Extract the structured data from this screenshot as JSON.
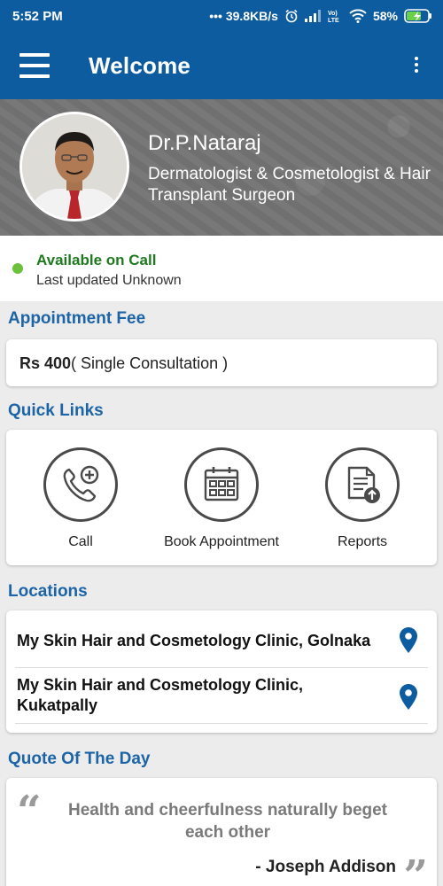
{
  "status_bar": {
    "time": "5:52 PM",
    "network_speed": "••• 39.8KB/s",
    "battery": "58%",
    "icons": [
      "alarm-icon",
      "signal-icon",
      "volte-icon",
      "wifi-icon",
      "battery-charging-icon"
    ]
  },
  "app_bar": {
    "title": "Welcome",
    "menu_icon": "hamburger-menu-icon",
    "overflow_icon": "more-vertical-icon"
  },
  "doctor": {
    "name": "Dr.P.Nataraj",
    "specialty": "Dermatologist & Cosmetologist & Hair Transplant Surgeon"
  },
  "availability": {
    "status": "Available on Call",
    "last_updated": "Last updated Unknown",
    "status_color": "#6cc13b"
  },
  "appointment_fee": {
    "section_title": "Appointment Fee",
    "amount": "Rs 400",
    "description": "( Single Consultation )"
  },
  "quick_links": {
    "section_title": "Quick Links",
    "items": [
      {
        "label": "Call",
        "icon": "phone-plus-icon"
      },
      {
        "label": "Book Appointment",
        "icon": "calendar-icon"
      },
      {
        "label": "Reports",
        "icon": "document-upload-icon"
      }
    ]
  },
  "locations": {
    "section_title": "Locations",
    "items": [
      {
        "name": "My Skin Hair  and Cosmetology Clinic, Golnaka",
        "icon": "map-pin-icon"
      },
      {
        "name": "My Skin Hair  and Cosmetology Clinic, Kukatpally",
        "icon": "map-pin-icon"
      }
    ]
  },
  "quote": {
    "section_title": "Quote Of The Day",
    "text": "Health and cheerfulness naturally beget each other",
    "author": "- Joseph Addison"
  },
  "colors": {
    "primary": "#0e5ca0",
    "section_title": "#1c64a6",
    "available": "#1f7a1f",
    "pin": "#0e5ca0"
  }
}
